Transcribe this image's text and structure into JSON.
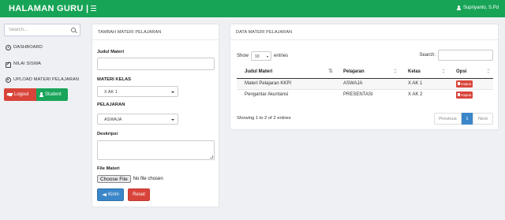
{
  "header": {
    "brand": "HALAMAN GURU |",
    "user_name": "Supriyanto, S.Pd"
  },
  "sidebar": {
    "search_placeholder": "Search...",
    "items": [
      {
        "label": "DASHBOARD"
      },
      {
        "label": "NILAI SISWA"
      },
      {
        "label": "UPLOAD MATERI PELAJARAN"
      }
    ],
    "logout_label": "Logout",
    "student_label": "Student"
  },
  "form": {
    "title": "TAMBAH MATERI PELAJARAN",
    "judul_label": "Judul Materi",
    "judul_value": "",
    "kelas_label": "MATERI KELAS",
    "kelas_value": "X AK 1",
    "pelajaran_label": "PELAJARAN",
    "pelajaran_value": "ASWAJA",
    "deskripsi_label": "Deskripsi",
    "file_label": "File Materi",
    "file_button": "Choose File",
    "file_status": "No file chosen",
    "submit_label": "Kirim",
    "reset_label": "Reset"
  },
  "table_panel": {
    "title": "DATA MATERI PELAJARAN",
    "show_label": "Show",
    "entries_value": "10",
    "entries_label": "entries",
    "search_label": "Search:",
    "columns": [
      "Judul Materi",
      "Pelajaran",
      "Kelas",
      "Opsi"
    ],
    "rows": [
      {
        "judul": "Materi Pelajaran KKPI",
        "pelajaran": "ASWAJA",
        "kelas": "X AK 1",
        "opsi": "Hapus"
      },
      {
        "judul": "Pengantar Akuntansi",
        "pelajaran": "PRESENTASI",
        "kelas": "X AK 2",
        "opsi": "Hapus"
      }
    ],
    "info": "Showing 1 to 2 of 2 entries",
    "pagination": {
      "previous": "Previous",
      "current": "1",
      "next": "Next"
    }
  },
  "colors": {
    "brand_green": "#17a456",
    "danger_red": "#d9443a",
    "primary_blue": "#3a86c8"
  }
}
